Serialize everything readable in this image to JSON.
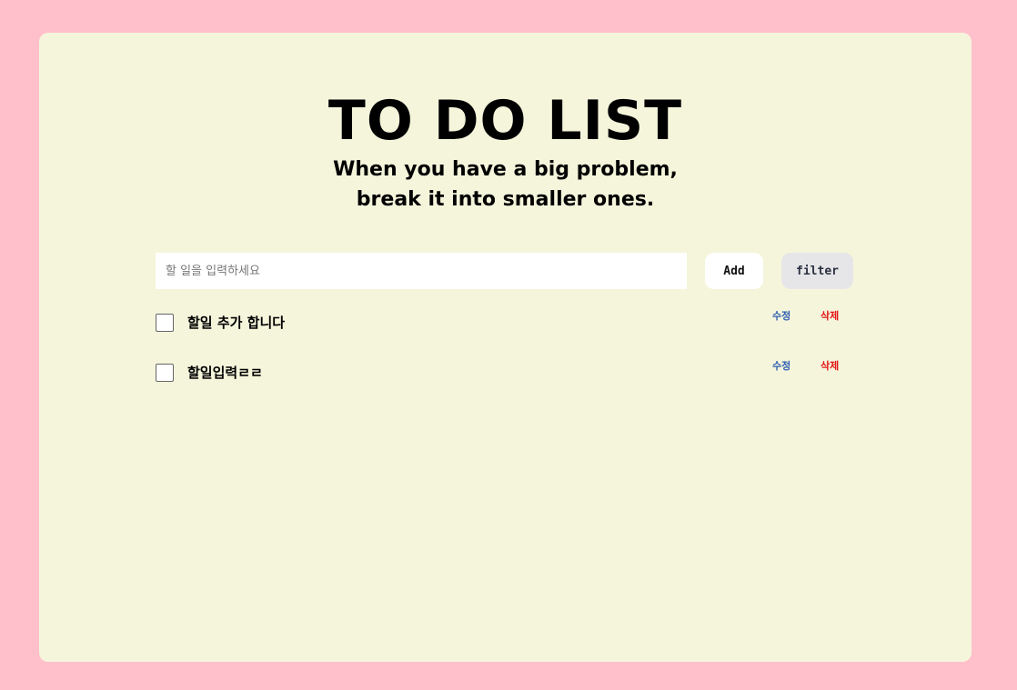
{
  "header": {
    "title": "TO DO LIST",
    "subtitle_line1": "When you have a big problem,",
    "subtitle_line2": "break it into smaller ones."
  },
  "form": {
    "input_value": "",
    "input_placeholder": "할 일을 입력하세요",
    "add_label": "Add",
    "filter_label": "filter"
  },
  "todos": [
    {
      "text": "할일 추가 합니다",
      "checked": false,
      "edit_label": "수정",
      "delete_label": "삭제"
    },
    {
      "text": "할일입력ㄹㄹ",
      "checked": false,
      "edit_label": "수정",
      "delete_label": "삭제"
    }
  ],
  "colors": {
    "page_background": "#ffc0cb",
    "card_background": "#f5f5dc",
    "edit_color": "#2f5fb0",
    "delete_color": "#e31414"
  }
}
